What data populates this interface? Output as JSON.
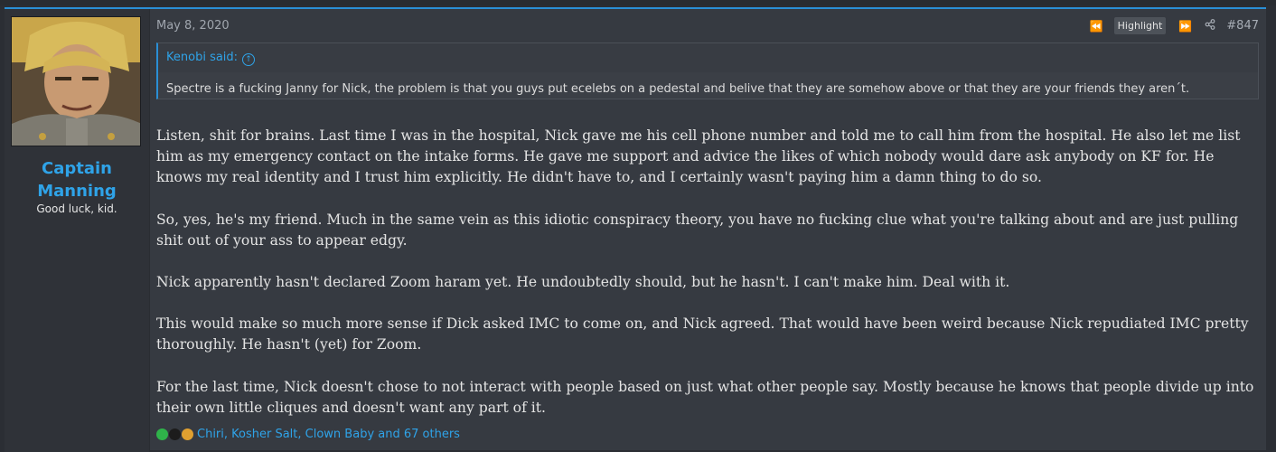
{
  "user": {
    "name": "Captain Manning",
    "title": "Good luck, kid."
  },
  "post": {
    "date": "May 8, 2020",
    "highlight_label": "Highlight",
    "number": "#847",
    "icons": [
      "rewind-icon",
      "fast-forward-icon",
      "share-icon"
    ],
    "quote": {
      "author_label": "Kenobi said:",
      "text": "Spectre is a fucking Janny for Nick, the problem is that you guys put ecelebs on a pedestal and belive that they are somehow above or that they are your friends they aren´t."
    },
    "paragraphs": [
      "Listen, shit for brains. Last time I was in the hospital, Nick gave me his cell phone number and told me to call him from the hospital. He also let me list him as my emergency contact on the intake forms. He gave me support and advice the likes of which nobody would dare ask anybody on KF for. He knows my real identity and I trust him explicitly. He didn't have to, and I certainly wasn't paying him a damn thing to do so.",
      "So, yes, he's my friend. Much in the same vein as this idiotic conspiracy theory, you have no fucking clue what you're talking about and are just pulling shit out of your ass to appear edgy.",
      "Nick apparently hasn't declared Zoom haram yet. He undoubtedly should, but he hasn't. I can't make him. Deal with it.",
      "This would make so much more sense if Dick asked IMC to come on, and Nick agreed. That would have been weird because Nick repudiated IMC pretty thoroughly. He hasn't (yet) for Zoom.",
      "For the last time, Nick doesn't chose to not interact with people based on just what other people say. Mostly because he knows that people divide up into their own little cliques and doesn't want any part of it."
    ],
    "reactions_text": "Chiri, Kosher Salt, Clown Baby and 67 others",
    "reaction_icon_colors": [
      "#2fb34a",
      "#1c1c1c",
      "#e0a030"
    ]
  },
  "colors": {
    "accent": "#2fa3e8",
    "post_bg": "#363a41",
    "sidebar_bg": "#2f3238"
  }
}
